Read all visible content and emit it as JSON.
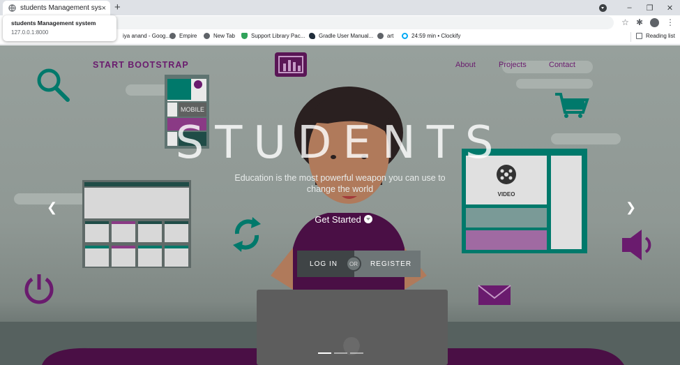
{
  "browser": {
    "tab_title": "students Management system",
    "tab_close": "×",
    "new_tab": "+",
    "hovercard": {
      "title": "students Management system",
      "url": "127.0.0.1:8000"
    },
    "window_controls": {
      "minimize": "–",
      "restore": "❐",
      "close": "✕"
    },
    "toolbar": {
      "star": "☆",
      "extensions": "✱",
      "menu": "⋮"
    },
    "bookmarks": [
      {
        "label": "iya anand - Goog...",
        "icon": "google-icon"
      },
      {
        "label": "Empire",
        "icon": "globe-icon"
      },
      {
        "label": "New Tab",
        "icon": "globe-icon"
      },
      {
        "label": "Support Library Pac...",
        "icon": "android-icon"
      },
      {
        "label": "Gradle User Manual...",
        "icon": "gradle-icon"
      },
      {
        "label": "art",
        "icon": "globe-icon"
      },
      {
        "label": "24:59 min • Clockify",
        "icon": "clockify-icon"
      }
    ],
    "reading_list": "Reading list"
  },
  "page": {
    "brand": "START BOOTSTRAP",
    "nav": [
      "About",
      "Projects",
      "Contact"
    ],
    "hero_title": "STUDENTS",
    "hero_subtitle": "Education is the most powerful weapon you can use to change the world",
    "get_started": "Get Started",
    "login": "LOG IN",
    "or": "OR",
    "register": "REGISTER",
    "prev_arrow": "❮",
    "next_arrow": "❯",
    "illustration": {
      "mobile_label": "MOBILE",
      "video_label": "VIDEO"
    },
    "colors": {
      "brand_purple": "#6a1b6e",
      "teal": "#00796b",
      "hero_bg": "#939c98"
    }
  }
}
